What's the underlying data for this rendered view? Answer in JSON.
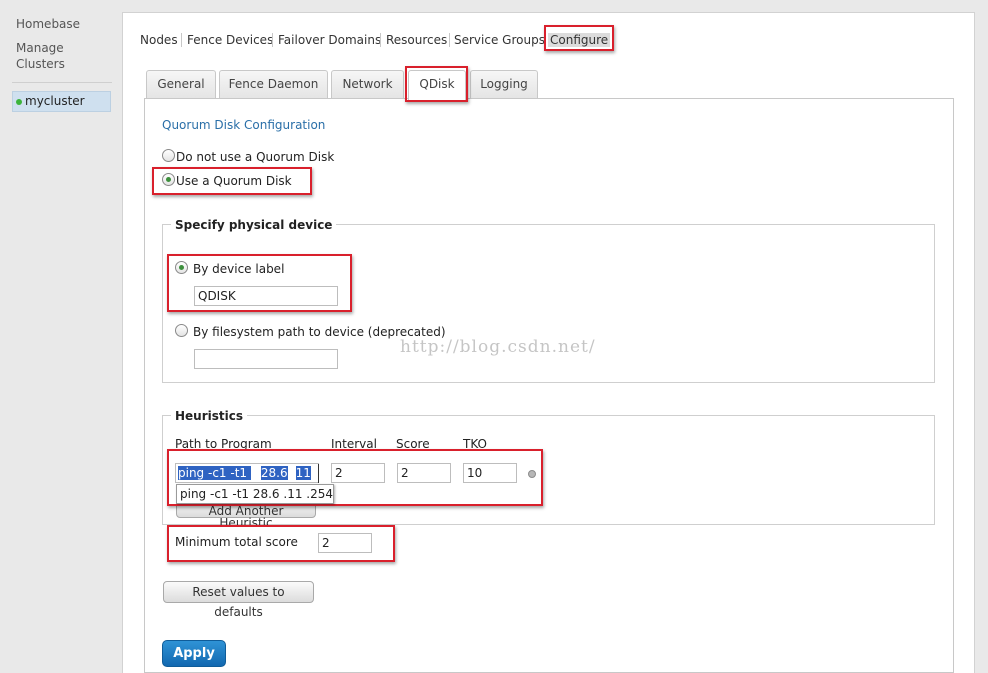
{
  "sidebar": {
    "homebase": "Homebase",
    "manage_line1": "Manage",
    "manage_line2": "Clusters",
    "cluster": "mycluster",
    "cluster_status_color": "#3cb43c"
  },
  "nav": {
    "items": [
      "Nodes",
      "Fence Devices",
      "Failover Domains",
      "Resources",
      "Service Groups",
      "Configure"
    ],
    "active": "Configure"
  },
  "tabs": {
    "items": [
      "General",
      "Fence Daemon",
      "Network",
      "QDisk",
      "Logging"
    ],
    "active": "QDisk"
  },
  "qdisk": {
    "title": "Quorum Disk Configuration",
    "option_no": "Do not use a Quorum Disk",
    "option_yes": "Use a Quorum Disk",
    "selected": "Use a Quorum Disk"
  },
  "device": {
    "legend": "Specify physical device",
    "by_label": "By device label",
    "label_value": "QDISK",
    "by_path": "By filesystem path to device (deprecated)",
    "path_value": ""
  },
  "heuristics": {
    "legend": "Heuristics",
    "headers": [
      "Path to Program",
      "Interval",
      "Score",
      "TKO"
    ],
    "rows": [
      {
        "program_part1": "ping -c1 -t1 ",
        "program_part2": "28.6",
        "program_part3": "11",
        "interval": "2",
        "score": "2",
        "tko": "10"
      }
    ],
    "autocomplete": "ping -c1 -t1   28.6  .11  .254",
    "add_button": "Add Another Heuristic",
    "min_score_label": "Minimum total score",
    "min_score_value": "2"
  },
  "buttons": {
    "reset": "Reset values to defaults",
    "apply": "Apply"
  },
  "watermark": "http://blog.csdn.net/",
  "colors": {
    "highlight": "#d9202c",
    "link": "#2a6fa8",
    "primary": "#1a78c2"
  }
}
